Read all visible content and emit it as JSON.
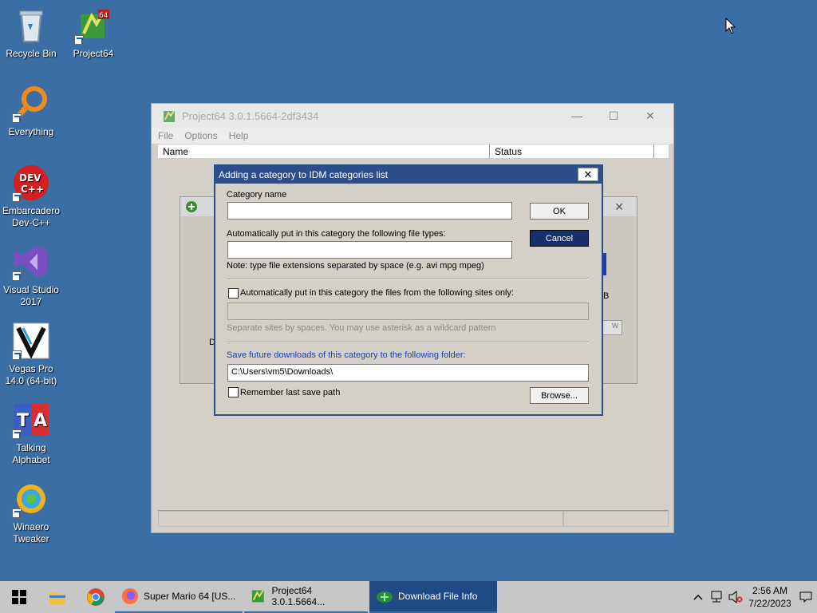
{
  "desktop": {
    "icons": [
      {
        "label": "Recycle Bin"
      },
      {
        "label": "Project64"
      },
      {
        "label": "Everything"
      },
      {
        "label": "Embarcadero Dev-C++"
      },
      {
        "label": "Visual Studio 2017"
      },
      {
        "label": "Vegas Pro 14.0 (64-bit)"
      },
      {
        "label": "Talking Alphabet"
      },
      {
        "label": "Winaero Tweaker"
      }
    ]
  },
  "main_window": {
    "title": "Project64 3.0.1.5664-2df3434",
    "menu": [
      "File",
      "Options",
      "Help"
    ],
    "columns": {
      "name": "Name",
      "status": "Status"
    },
    "controls": {
      "minimize": "—",
      "maximize": "☐",
      "close": "✕"
    }
  },
  "bg_dialog": {
    "title": "Download File Info",
    "snippet_b": "B",
    "snippet_d": "D",
    "snippet_w": "w"
  },
  "dialog": {
    "title": "Adding a category to IDM categories list",
    "category_name_label": "Category name",
    "category_name_value": "",
    "file_types_label": "Automatically put in this category the following file types:",
    "file_types_value": "",
    "note": "Note: type file extensions separated by space (e.g. avi mpg mpeg)",
    "sites_checkbox_label": "Automatically put in this category the files from the following sites only:",
    "sites_value": "",
    "sites_hint": "Separate sites by spaces. You may use asterisk as a wildcard pattern",
    "folder_label": "Save future downloads of this category to the following folder:",
    "folder_value": "C:\\Users\\vm5\\Downloads\\",
    "remember_label": "Remember last save path",
    "ok_label": "OK",
    "cancel_label": "Cancel",
    "browse_label": "Browse...",
    "close_glyph": "✕",
    "colors": {
      "title_bg": "#2b4d8c",
      "folder_label": "#1a3fb0",
      "disabled_text": "#8a8a8a"
    }
  },
  "taskbar": {
    "items": [
      {
        "label": "Super Mario 64 [US..."
      },
      {
        "label": "Project64 3.0.1.5664..."
      },
      {
        "label": "Download File Info"
      }
    ],
    "time": "2:56 AM",
    "date": "7/22/2023"
  }
}
